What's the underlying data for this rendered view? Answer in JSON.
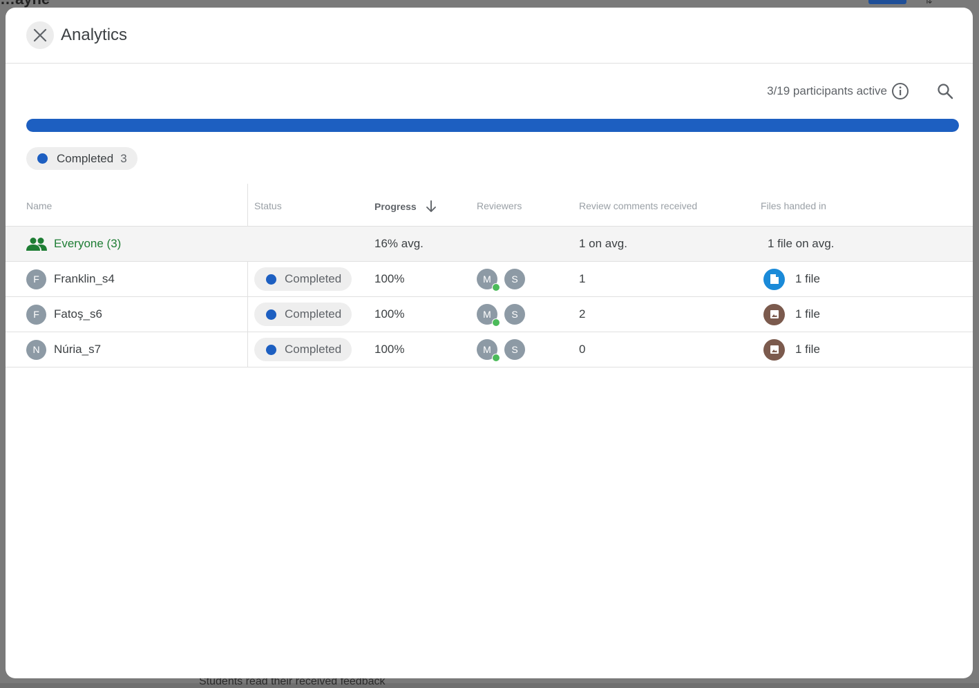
{
  "background": {
    "app_title": "…ayne",
    "footer_text": "Students read their received feedback"
  },
  "modal": {
    "title": "Analytics",
    "active_text": "3/19 participants active",
    "progress_bar": {
      "completed_fraction": 1.0,
      "color": "#1d5fc1"
    },
    "legend": {
      "label": "Completed",
      "count": "3",
      "color": "#1d5fc1"
    },
    "columns": {
      "name": "Name",
      "status": "Status",
      "progress": "Progress",
      "reviewers": "Reviewers",
      "review_comments": "Review comments received",
      "files": "Files handed in"
    },
    "everyone": {
      "label": "Everyone (3)",
      "progress": "16% avg.",
      "comments": "1 on avg.",
      "files": "1 file on avg."
    },
    "rows": [
      {
        "initial": "F",
        "name": "Franklin_s4",
        "status": "Completed",
        "progress": "100%",
        "reviewers": [
          "M",
          "S"
        ],
        "comments": "1",
        "file_type": "doc",
        "files": "1 file"
      },
      {
        "initial": "F",
        "name": "Fatoş_s6",
        "status": "Completed",
        "progress": "100%",
        "reviewers": [
          "M",
          "S"
        ],
        "comments": "2",
        "file_type": "image",
        "files": "1 file"
      },
      {
        "initial": "N",
        "name": "Núria_s7",
        "status": "Completed",
        "progress": "100%",
        "reviewers": [
          "M",
          "S"
        ],
        "comments": "0",
        "file_type": "image",
        "files": "1 file"
      }
    ]
  },
  "colors": {
    "accent": "#1d5fc1",
    "everyone_green": "#1e7d34",
    "online_green": "#4cbb5a",
    "doc_blue": "#1a8ad8",
    "image_brown": "#7b5a4d"
  }
}
